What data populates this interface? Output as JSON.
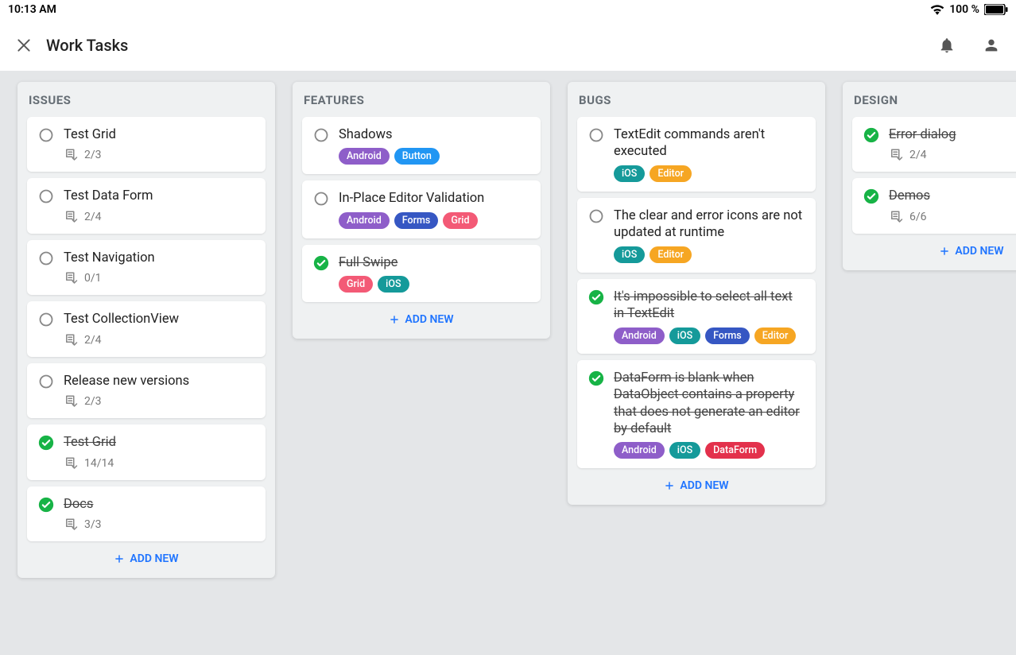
{
  "status": {
    "time": "10:13 AM",
    "battery": "100 %"
  },
  "app": {
    "title": "Work Tasks"
  },
  "addNewLabel": "ADD NEW",
  "tagColors": {
    "Android": "#8e5ec9",
    "Button": "#2196f3",
    "Forms": "#3657c3",
    "Grid": "#f35a76",
    "iOS": "#159a9a",
    "Editor": "#f6a623",
    "DataForm": "#e3314c"
  },
  "columns": [
    {
      "title": "ISSUES",
      "cards": [
        {
          "title": "Test Grid",
          "done": false,
          "count": "2/3"
        },
        {
          "title": "Test Data Form",
          "done": false,
          "count": "2/4"
        },
        {
          "title": "Test Navigation",
          "done": false,
          "count": "0/1"
        },
        {
          "title": "Test CollectionView",
          "done": false,
          "count": "2/4"
        },
        {
          "title": "Release new versions",
          "done": false,
          "count": "2/3"
        },
        {
          "title": "Test Grid",
          "done": true,
          "count": "14/14"
        },
        {
          "title": "Docs",
          "done": true,
          "count": "3/3"
        }
      ]
    },
    {
      "title": "FEATURES",
      "cards": [
        {
          "title": "Shadows",
          "done": false,
          "tags": [
            "Android",
            "Button"
          ]
        },
        {
          "title": "In-Place Editor Validation",
          "done": false,
          "tags": [
            "Android",
            "Forms",
            "Grid"
          ]
        },
        {
          "title": "Full Swipe",
          "done": true,
          "tags": [
            "Grid",
            "iOS"
          ]
        }
      ]
    },
    {
      "title": "BUGS",
      "cards": [
        {
          "title": "TextEdit commands aren't executed",
          "done": false,
          "tags": [
            "iOS",
            "Editor"
          ]
        },
        {
          "title": "The clear and error icons are not updated at runtime",
          "done": false,
          "tags": [
            "iOS",
            "Editor"
          ]
        },
        {
          "title": "It's impossible to select all text in TextEdit",
          "done": true,
          "tags": [
            "Android",
            "iOS",
            "Forms",
            "Editor"
          ]
        },
        {
          "title": "DataForm is blank when DataObject contains a property that does not generate an editor by default",
          "done": true,
          "tags": [
            "Android",
            "iOS",
            "DataForm"
          ]
        }
      ]
    },
    {
      "title": "DESIGN",
      "cards": [
        {
          "title": "Error dialog",
          "done": true,
          "count": "2/4"
        },
        {
          "title": "Demos",
          "done": true,
          "count": "6/6"
        }
      ]
    }
  ]
}
